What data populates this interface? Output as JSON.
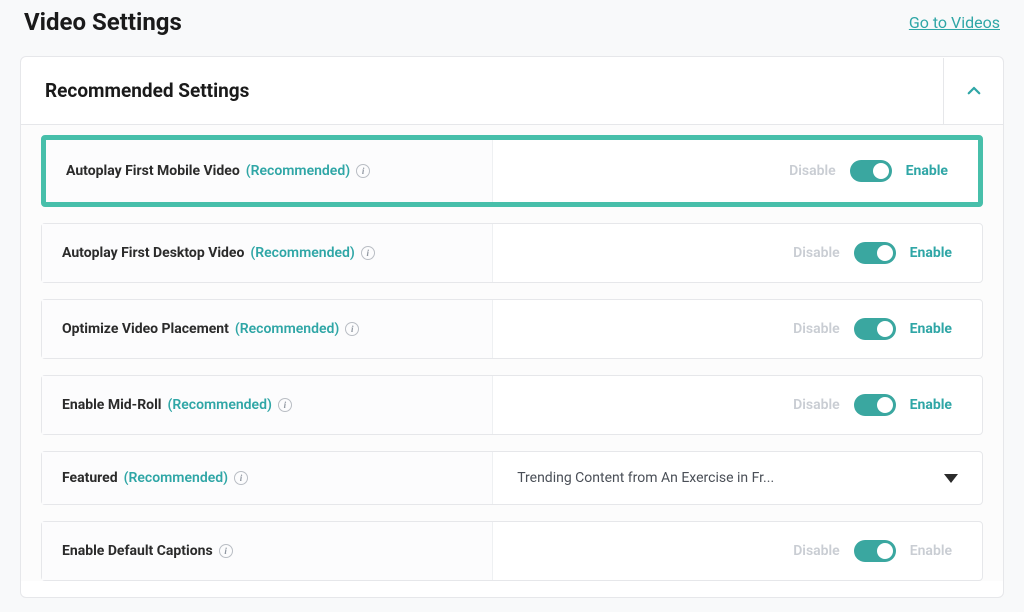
{
  "header": {
    "title": "Video Settings",
    "link_text": "Go to Videos"
  },
  "panel": {
    "title": "Recommended Settings"
  },
  "labels": {
    "disable": "Disable",
    "enable": "Enable",
    "recommended": "(Recommended)",
    "info_glyph": "i"
  },
  "settings": {
    "autoplay_mobile": {
      "label": "Autoplay First Mobile Video",
      "recommended": true,
      "enabled": true,
      "highlighted": true
    },
    "autoplay_desktop": {
      "label": "Autoplay First Desktop Video",
      "recommended": true,
      "enabled": true
    },
    "optimize_placement": {
      "label": "Optimize Video Placement",
      "recommended": true,
      "enabled": true
    },
    "mid_roll": {
      "label": "Enable Mid-Roll",
      "recommended": true,
      "enabled": true
    },
    "featured": {
      "label": "Featured",
      "recommended": true,
      "selected_text": "Trending Content from An Exercise in Fr..."
    },
    "default_captions": {
      "label": "Enable Default Captions",
      "recommended": false,
      "enabled": true,
      "enable_label_muted": true
    }
  }
}
